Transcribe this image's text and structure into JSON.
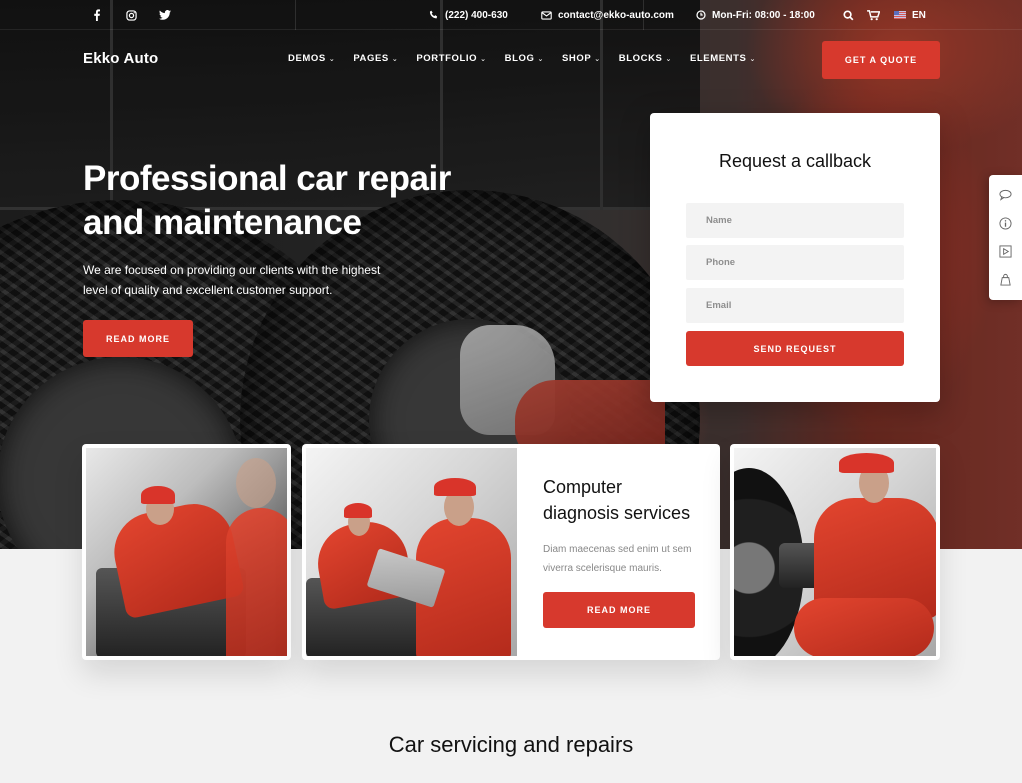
{
  "topbar": {
    "social": [
      {
        "icon": "facebook-icon",
        "glyph": "f"
      },
      {
        "icon": "instagram-icon",
        "glyph": "◎"
      },
      {
        "icon": "twitter-icon",
        "glyph": "🐦"
      }
    ],
    "phone": "(222) 400-630",
    "email": "contact@ekko-auto.com",
    "hours": "Mon-Fri: 08:00 - 18:00",
    "language": "EN"
  },
  "header": {
    "logo": "Ekko Auto",
    "nav": [
      {
        "label": "DEMOS"
      },
      {
        "label": "PAGES"
      },
      {
        "label": "PORTFOLIO"
      },
      {
        "label": "BLOG"
      },
      {
        "label": "SHOP"
      },
      {
        "label": "BLOCKS"
      },
      {
        "label": "ELEMENTS"
      }
    ],
    "cta_label": "GET A QUOTE"
  },
  "hero": {
    "title": "Professional car repair and maintenance",
    "subtitle": "We are focused on providing our clients with the highest level of quality and excellent customer support.",
    "button_label": "READ MORE"
  },
  "callback_form": {
    "title": "Request a callback",
    "fields": [
      {
        "placeholder": "Name",
        "value": ""
      },
      {
        "placeholder": "Phone",
        "value": ""
      },
      {
        "placeholder": "Email",
        "value": ""
      }
    ],
    "submit_label": "SEND REQUEST"
  },
  "side_tools": [
    {
      "icon": "chat-icon"
    },
    {
      "icon": "info-icon"
    },
    {
      "icon": "video-icon"
    },
    {
      "icon": "shopping-bag-icon"
    }
  ],
  "cards": {
    "featured": {
      "title": "Computer diagnosis services",
      "text": "Diam maecenas sed enim ut sem viverra scelerisque mauris.",
      "button_label": "READ MORE"
    }
  },
  "section": {
    "title": "Car servicing and repairs"
  },
  "colors": {
    "accent": "#d7392d",
    "dark": "#222222",
    "light_bg": "#f2f2f2"
  }
}
